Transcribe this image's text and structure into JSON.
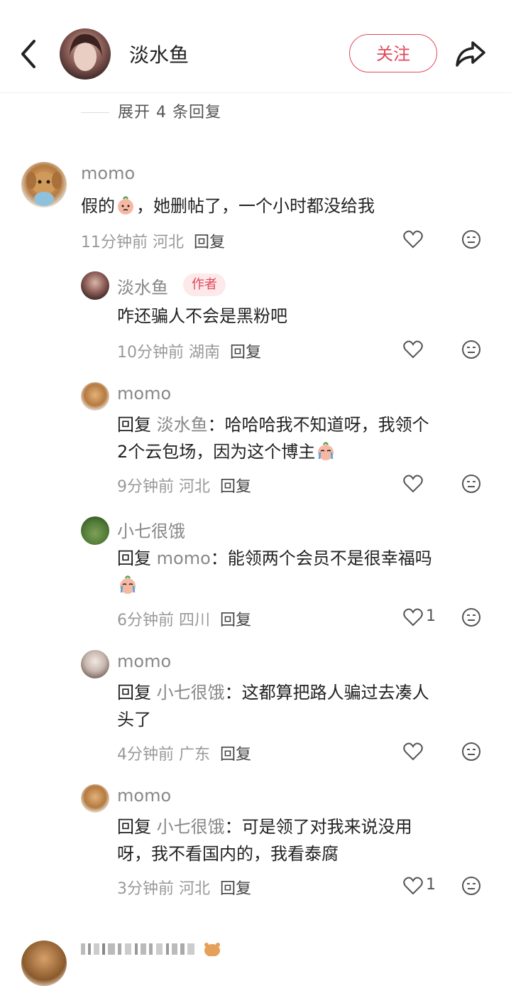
{
  "header": {
    "username": "淡水鱼",
    "follow_label": "关注"
  },
  "expand_label": "展开 4 条回复",
  "author_badge": "作者",
  "reply_label": "回复",
  "reply_prefix": "回复",
  "comments": [
    {
      "author": "momo",
      "text": "假的",
      "text_after_emoji": "，她删帖了，一个小时都没给我",
      "time": "11分钟前",
      "location": "河北"
    }
  ],
  "replies": [
    {
      "author": "淡水鱼",
      "text": "咋还骗人不会是黑粉吧",
      "time": "10分钟前",
      "location": "湖南"
    },
    {
      "author": "momo",
      "reply_to": "淡水鱼",
      "text_line1": "：哈哈哈我不知道呀，我领个",
      "text_line2": "2个云包场，因为这个博主",
      "time": "9分钟前",
      "location": "河北"
    },
    {
      "author": "小七很饿",
      "reply_to": "momo",
      "text_line1": "：能领两个会员不是很幸福吗",
      "time": "6分钟前",
      "location": "四川",
      "likes": "1"
    },
    {
      "author": "momo",
      "reply_to": "小七很饿",
      "text_line1": "：这都算把路人骗过去凑人",
      "text_line2": "头了",
      "time": "4分钟前",
      "location": "广东"
    },
    {
      "author": "momo",
      "reply_to": "小七很饿",
      "text_line1": "：可是领了对我来说没用",
      "text_line2": "呀，我不看国内的，我看泰腐",
      "time": "3分钟前",
      "location": "河北",
      "likes": "1"
    }
  ]
}
